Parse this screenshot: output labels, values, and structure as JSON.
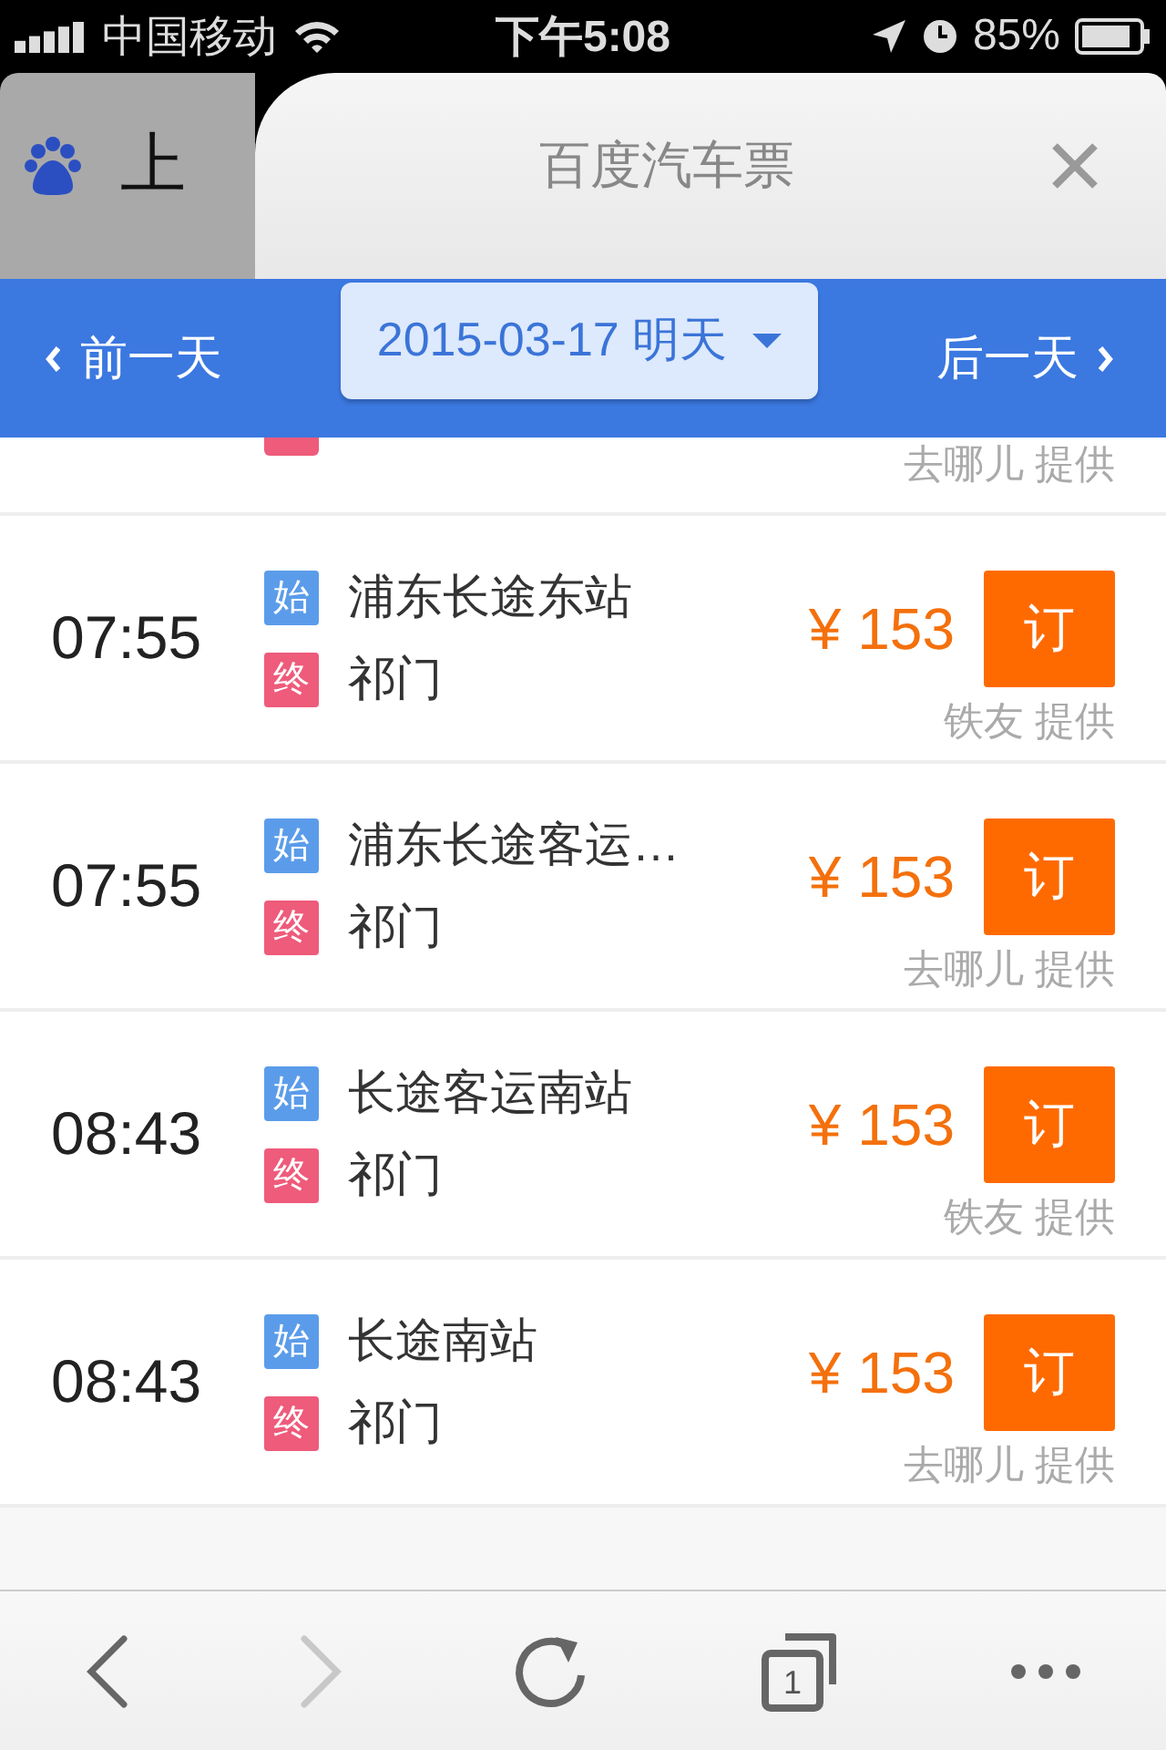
{
  "status_bar": {
    "carrier": "中国移动",
    "time": "下午5:08",
    "battery": "85%"
  },
  "browser": {
    "back_tab_title": "上",
    "title": "百度汽车票"
  },
  "date_bar": {
    "prev": "前一天",
    "date": "2015-03-17 明天",
    "next": "后一天"
  },
  "partial_row": {
    "provider": "去哪儿 提供"
  },
  "trips": [
    {
      "time": "07:55",
      "from_badge": "始",
      "from": "浦东长途东站",
      "to_badge": "终",
      "to": "祁门",
      "price": "¥ 153",
      "book": "订",
      "provider": "铁友 提供"
    },
    {
      "time": "07:55",
      "from_badge": "始",
      "from": "浦东长途客运…",
      "to_badge": "终",
      "to": "祁门",
      "price": "¥ 153",
      "book": "订",
      "provider": "去哪儿 提供"
    },
    {
      "time": "08:43",
      "from_badge": "始",
      "from": "长途客运南站",
      "to_badge": "终",
      "to": "祁门",
      "price": "¥ 153",
      "book": "订",
      "provider": "铁友 提供"
    },
    {
      "time": "08:43",
      "from_badge": "始",
      "from": "长途南站",
      "to_badge": "终",
      "to": "祁门",
      "price": "¥ 153",
      "book": "订",
      "provider": "去哪儿 提供"
    }
  ],
  "toolbar": {
    "tab_count": "1",
    "forward_disabled": true
  }
}
